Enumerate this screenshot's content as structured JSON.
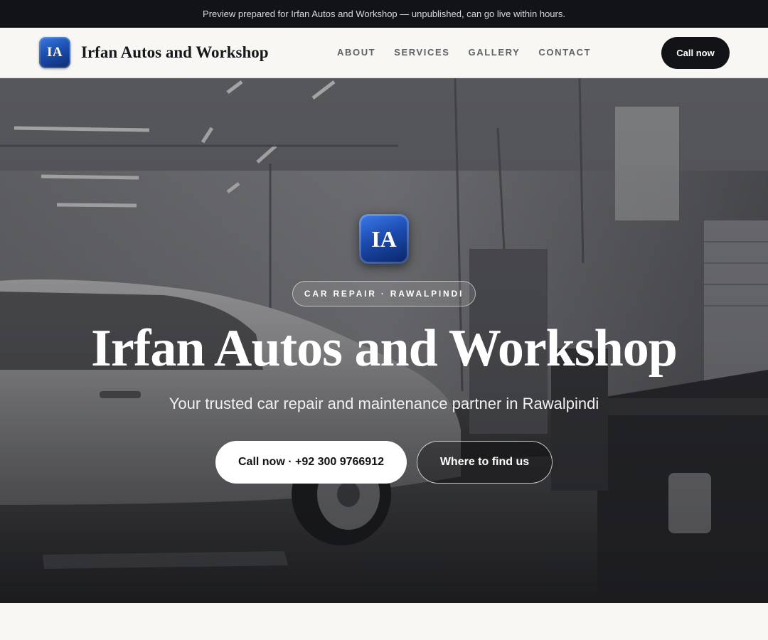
{
  "banner": {
    "text": "Preview prepared for Irfan Autos and Workshop — unpublished, can go live within hours."
  },
  "header": {
    "logo_initials": "IA",
    "brand_name": "Irfan Autos and Workshop",
    "nav": [
      {
        "label": "ABOUT"
      },
      {
        "label": "SERVICES"
      },
      {
        "label": "GALLERY"
      },
      {
        "label": "CONTACT"
      }
    ],
    "cta_label": "Call now"
  },
  "hero": {
    "logo_initials": "IA",
    "tag": "CAR REPAIR · RAWALPINDI",
    "title": "Irfan Autos and Workshop",
    "subtitle": "Your trusted car repair and maintenance partner in Rawalpindi",
    "primary_button": "Call now · +92 300 9766912",
    "secondary_button": "Where to find us",
    "background_image": "workshop-garage-photo"
  },
  "colors": {
    "banner_bg": "#111317",
    "nav_bg": "#f8f7f4",
    "cta_bg": "#111317",
    "logo_blue": "#1c4fb0",
    "hero_text": "#ffffff"
  }
}
